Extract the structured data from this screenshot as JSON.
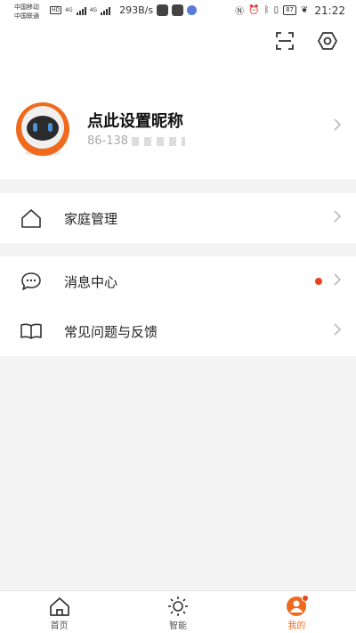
{
  "status_bar": {
    "carrier_1": "中国移动",
    "carrier_2": "中国联通",
    "hd": "HD",
    "net_1": "4G",
    "net_2": "4G",
    "speed": "293B/s",
    "battery": "87",
    "time": "21:22"
  },
  "profile": {
    "nickname": "点此设置昵称",
    "phone": "86-138"
  },
  "menu": {
    "home_management": "家庭管理",
    "messages": "消息中心",
    "faq": "常见问题与反馈"
  },
  "nav": {
    "home": "首页",
    "smart": "智能",
    "mine": "我的"
  },
  "colors": {
    "accent": "#f06a1e",
    "badge": "#e8441c"
  }
}
